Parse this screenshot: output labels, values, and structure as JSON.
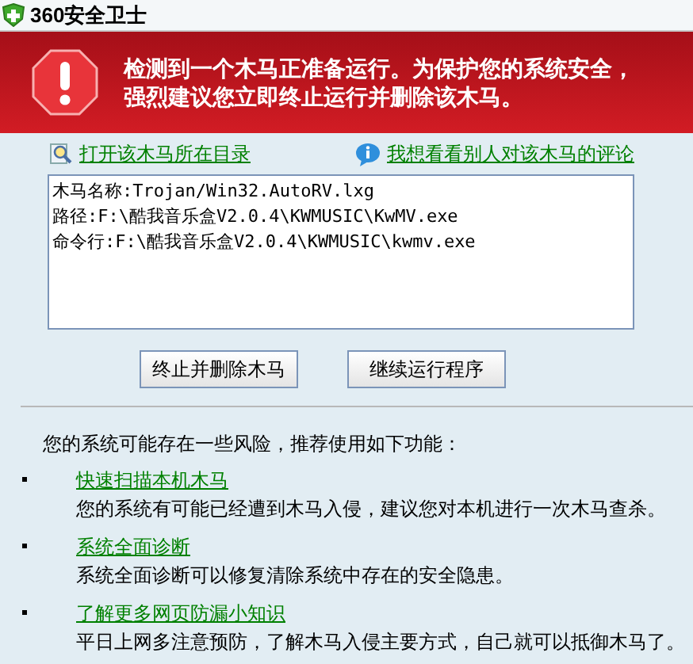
{
  "window": {
    "title": "360安全卫士"
  },
  "alert": {
    "message_lines": [
      "检测到一个木马正准备运行。为保护您的系统安全，",
      "强烈建议您立即终止运行并删除该木马。"
    ]
  },
  "links": [
    {
      "kind": "folder",
      "label": "打开该木马所在目录"
    },
    {
      "kind": "comment",
      "label": "我想看看别人对该木马的评论"
    }
  ],
  "details": [
    "木马名称:Trojan/Win32.AutoRV.lxg",
    "路径:F:\\酷我音乐盒V2.0.4\\KWMUSIC\\KwMV.exe",
    "命令行:F:\\酷我音乐盒V2.0.4\\KWMUSIC\\kwmv.exe"
  ],
  "buttons": [
    "终止并删除木马",
    "继续运行程序"
  ],
  "recommend": {
    "heading": "您的系统可能存在一些风险，推荐使用如下功能：",
    "items": [
      {
        "link": "快速扫描本机木马",
        "description": "您的系统有可能已经遭到木马入侵，建议您对本机进行一次木马查杀。"
      },
      {
        "link": "系统全面诊断",
        "description": "系统全面诊断可以修复清除系统中存在的安全隐患。"
      },
      {
        "link": "了解更多网页防漏小知识",
        "description": "平日上网多注意预防，了解木马入侵主要方式，自己就可以抵御木马了。"
      }
    ]
  }
}
